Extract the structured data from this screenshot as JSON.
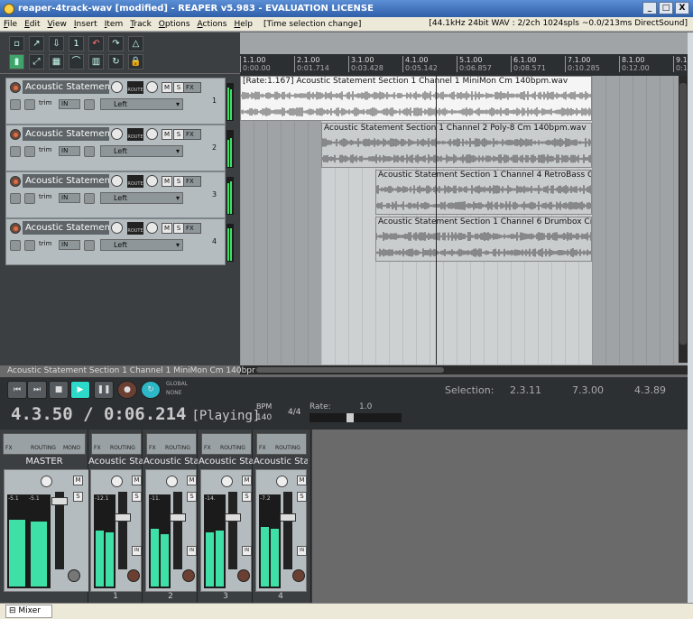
{
  "window": {
    "title": "reaper-4track-wav [modified] - REAPER v5.983 - EVALUATION LICENSE",
    "controls": [
      "_",
      "□",
      "X"
    ]
  },
  "menu": {
    "items": [
      "File",
      "Edit",
      "View",
      "Insert",
      "Item",
      "Track",
      "Options",
      "Actions",
      "Help"
    ],
    "status": "[Time selection change]",
    "device_info": "[44.1kHz 24bit WAV : 2/2ch 1024spls ~0.0/213ms DirectSound]"
  },
  "ruler": {
    "marks": [
      {
        "bar": "1.1.00",
        "time": "0:00.00"
      },
      {
        "bar": "2.1.00",
        "time": "0:01.714"
      },
      {
        "bar": "3.1.00",
        "time": "0:03.428"
      },
      {
        "bar": "4.1.00",
        "time": "0:05.142"
      },
      {
        "bar": "5.1.00",
        "time": "0:06.857"
      },
      {
        "bar": "6.1.00",
        "time": "0:08.571"
      },
      {
        "bar": "7.1.00",
        "time": "0:10.285"
      },
      {
        "bar": "8.1.00",
        "time": "0:12.00"
      },
      {
        "bar": "9.1",
        "time": "0:1"
      }
    ]
  },
  "tracks": [
    {
      "name": "Acoustic Statement",
      "number": "1",
      "route": "ROUTE",
      "mute": "M",
      "solo": "S",
      "fx": "FX",
      "trim": "trim",
      "input": "IN",
      "channel": "Left"
    },
    {
      "name": "Acoustic Statement",
      "number": "2",
      "route": "ROUTE",
      "mute": "M",
      "solo": "S",
      "fx": "FX",
      "trim": "trim",
      "input": "IN",
      "channel": "Left"
    },
    {
      "name": "Acoustic Statement",
      "number": "3",
      "route": "ROUTE",
      "mute": "M",
      "solo": "S",
      "fx": "FX",
      "trim": "trim",
      "input": "IN",
      "channel": "Left"
    },
    {
      "name": "Acoustic Statement",
      "number": "4",
      "route": "ROUTE",
      "mute": "M",
      "solo": "S",
      "fx": "FX",
      "trim": "trim",
      "input": "IN",
      "channel": "Left"
    }
  ],
  "items": [
    "[Rate:1.167] Acoustic Statement Section 1 Channel 1 MiniMon Cm 140bpm.wav",
    "Acoustic Statement Section 1 Channel 2 Poly-8 Cm 140bpm.wav",
    "Acoustic Statement Section 1 Channel 4 RetroBass Cm 14",
    "Acoustic Statement Section 1 Channel 6 Drumbox Cm 140"
  ],
  "selected_item_name": "Acoustic Statement Section 1 Channel 1 MiniMon Cm 140bpr",
  "transport": {
    "position": "4.3.50 / 0:06.214",
    "state": "[Playing]",
    "bpm_label": "BPM",
    "bpm": "140",
    "time_signature": "4/4",
    "rate_label": "Rate:",
    "rate_value": "1.0",
    "global_label": "GLOBAL",
    "none_label": "NONE",
    "selection_label": "Selection:",
    "selection_start": "2.3.11",
    "selection_end": "7.3.00",
    "selection_length": "4.3.89",
    "rate": 0.44
  },
  "mixer": {
    "master": {
      "name": "MASTER",
      "peak_l": "-5.1",
      "peak_r": "-5.1",
      "fx": "FX",
      "routing": "ROUTING",
      "mono": "MONO",
      "mute": "M",
      "solo": "S"
    },
    "strips": [
      {
        "name": "Acoustic Sta",
        "number": "1",
        "peak": "-12.1",
        "routing": "ROUTING",
        "fx": "FX",
        "mute": "M",
        "solo": "S",
        "in": "IN"
      },
      {
        "name": "Acoustic Sta",
        "number": "2",
        "peak": "-11.",
        "routing": "ROUTING",
        "fx": "FX",
        "mute": "M",
        "solo": "S",
        "in": "IN"
      },
      {
        "name": "Acoustic Sta",
        "number": "3",
        "peak": "-14.",
        "routing": "ROUTING",
        "fx": "FX",
        "mute": "M",
        "solo": "S",
        "in": "IN"
      },
      {
        "name": "Acoustic Sta",
        "number": "4",
        "peak": "-7.2",
        "routing": "ROUTING",
        "fx": "FX",
        "mute": "M",
        "solo": "S",
        "in": "IN"
      }
    ]
  },
  "dock": {
    "tab": "Mixer"
  },
  "colors": {
    "accent_play": "#2dd9c8",
    "meter": "#3fe06a",
    "record": "#e56a3f"
  }
}
